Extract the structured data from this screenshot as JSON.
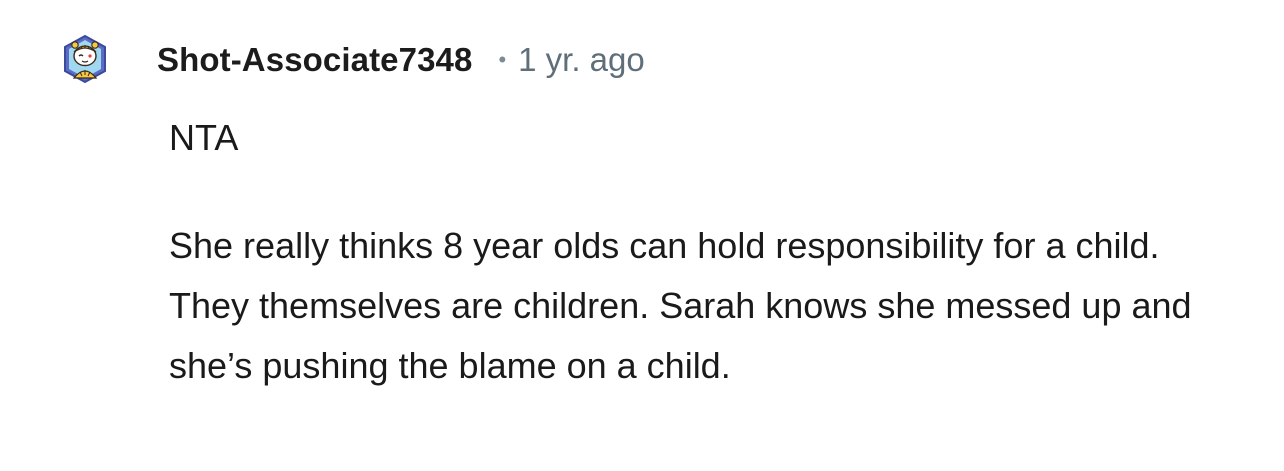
{
  "comment": {
    "avatar_icon": "snoo-tiger-avatar-icon",
    "username": "Shot-Associate7348",
    "separator": "•",
    "timestamp": "1 yr. ago",
    "paragraphs": [
      "NTA",
      "She really thinks 8 year olds can hold responsibility for a child. They themselves are children. Sarah knows she messed up and she’s pushing the blame on a child."
    ]
  },
  "colors": {
    "username": "#1c1c1c",
    "timestamp": "#5f6f7a",
    "body_text": "#1a1a1b",
    "background": "#ffffff"
  }
}
